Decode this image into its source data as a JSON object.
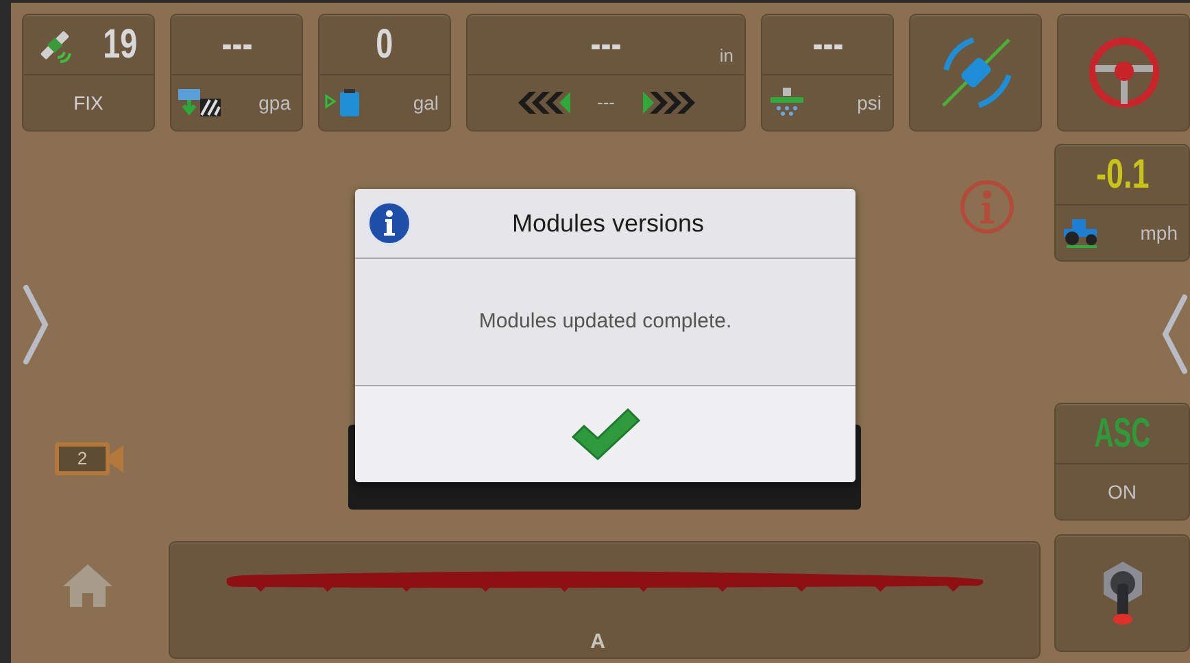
{
  "top_tiles": [
    {
      "kind": "gps",
      "value": "19",
      "label": "FIX"
    },
    {
      "kind": "rate",
      "value": "---",
      "unit": "gpa"
    },
    {
      "kind": "tank",
      "value": "0",
      "unit": "gal"
    },
    {
      "kind": "guidance",
      "value": "---",
      "unit": "in",
      "offset": "---"
    },
    {
      "kind": "pressure",
      "value": "---",
      "unit": "psi"
    },
    {
      "kind": "line"
    },
    {
      "kind": "steering"
    }
  ],
  "speed": {
    "value": "-0.1",
    "unit": "mph"
  },
  "asc": {
    "label": "ASC",
    "state": "ON"
  },
  "camera": {
    "number": "2"
  },
  "boom": {
    "label": "A"
  },
  "dialog": {
    "title": "Modules versions",
    "message": "Modules updated complete."
  }
}
